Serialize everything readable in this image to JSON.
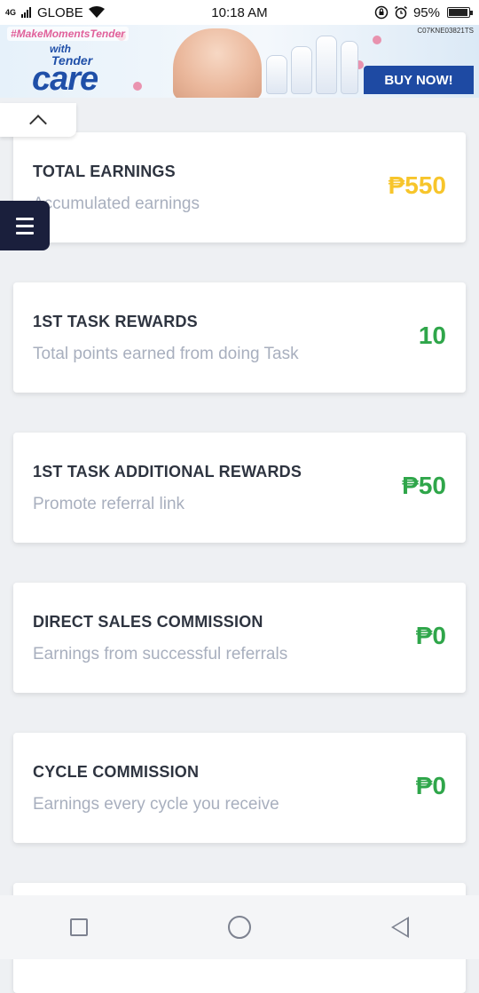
{
  "status_bar": {
    "network": "4G",
    "carrier": "GLOBE",
    "time": "10:18 AM",
    "battery": "95%",
    "battery_level": 0.95
  },
  "ad": {
    "tagline": "#MakeMomentsTender",
    "with": "with",
    "brand_top": "Tender",
    "brand": "care",
    "code": "C07KNE03821TS",
    "cta": "BUY NOW!"
  },
  "cards": [
    {
      "title": "TOTAL EARNINGS",
      "subtitle": "Accumulated earnings",
      "value": "₱550",
      "value_color": "#f7c52b"
    },
    {
      "title": "1ST TASK REWARDS",
      "subtitle": "Total points earned from doing Task",
      "value": "10",
      "value_color": "#2fa64a"
    },
    {
      "title": "1ST TASK ADDITIONAL REWARDS",
      "subtitle": "Promote referral link",
      "value": "₱50",
      "value_color": "#2fa64a"
    },
    {
      "title": "DIRECT SALES COMMISSION",
      "subtitle": "Earnings from successful referrals",
      "value": "₱0",
      "value_color": "#2fa64a"
    },
    {
      "title": "CYCLE COMMISSION",
      "subtitle": "Earnings every cycle you receive",
      "value": "₱0",
      "value_color": "#2fa64a"
    }
  ],
  "colors": {
    "menu_bg": "#1a1f3c",
    "gold": "#f7c52b",
    "green": "#2fa64a",
    "ad_cta": "#1e4aa3"
  },
  "icons": {
    "collapse": "chevron-up-icon",
    "menu": "hamburger-menu-icon",
    "nav_recent": "square-icon",
    "nav_home": "circle-icon",
    "nav_back": "triangle-back-icon"
  }
}
